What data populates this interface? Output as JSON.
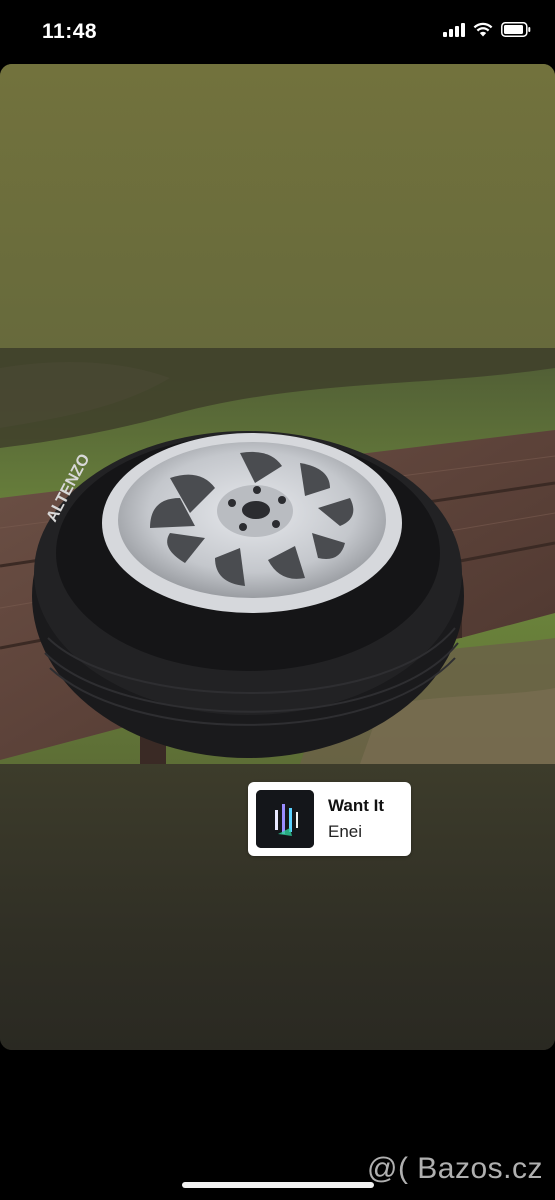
{
  "status_bar": {
    "time": "11:48"
  },
  "story": {
    "photo_alt": "Alloy wheel with ALTENZO tire on a wooden bench",
    "tire_brand_text": "ALTENZO",
    "music_sticker": {
      "title": "Want It",
      "artist": "Enei"
    }
  },
  "watermark": {
    "text": "@( Bazos.cz"
  },
  "colors": {
    "story_top": "#73733e",
    "story_bottom": "#2c2b23",
    "sticker_bg": "#ffffff"
  }
}
